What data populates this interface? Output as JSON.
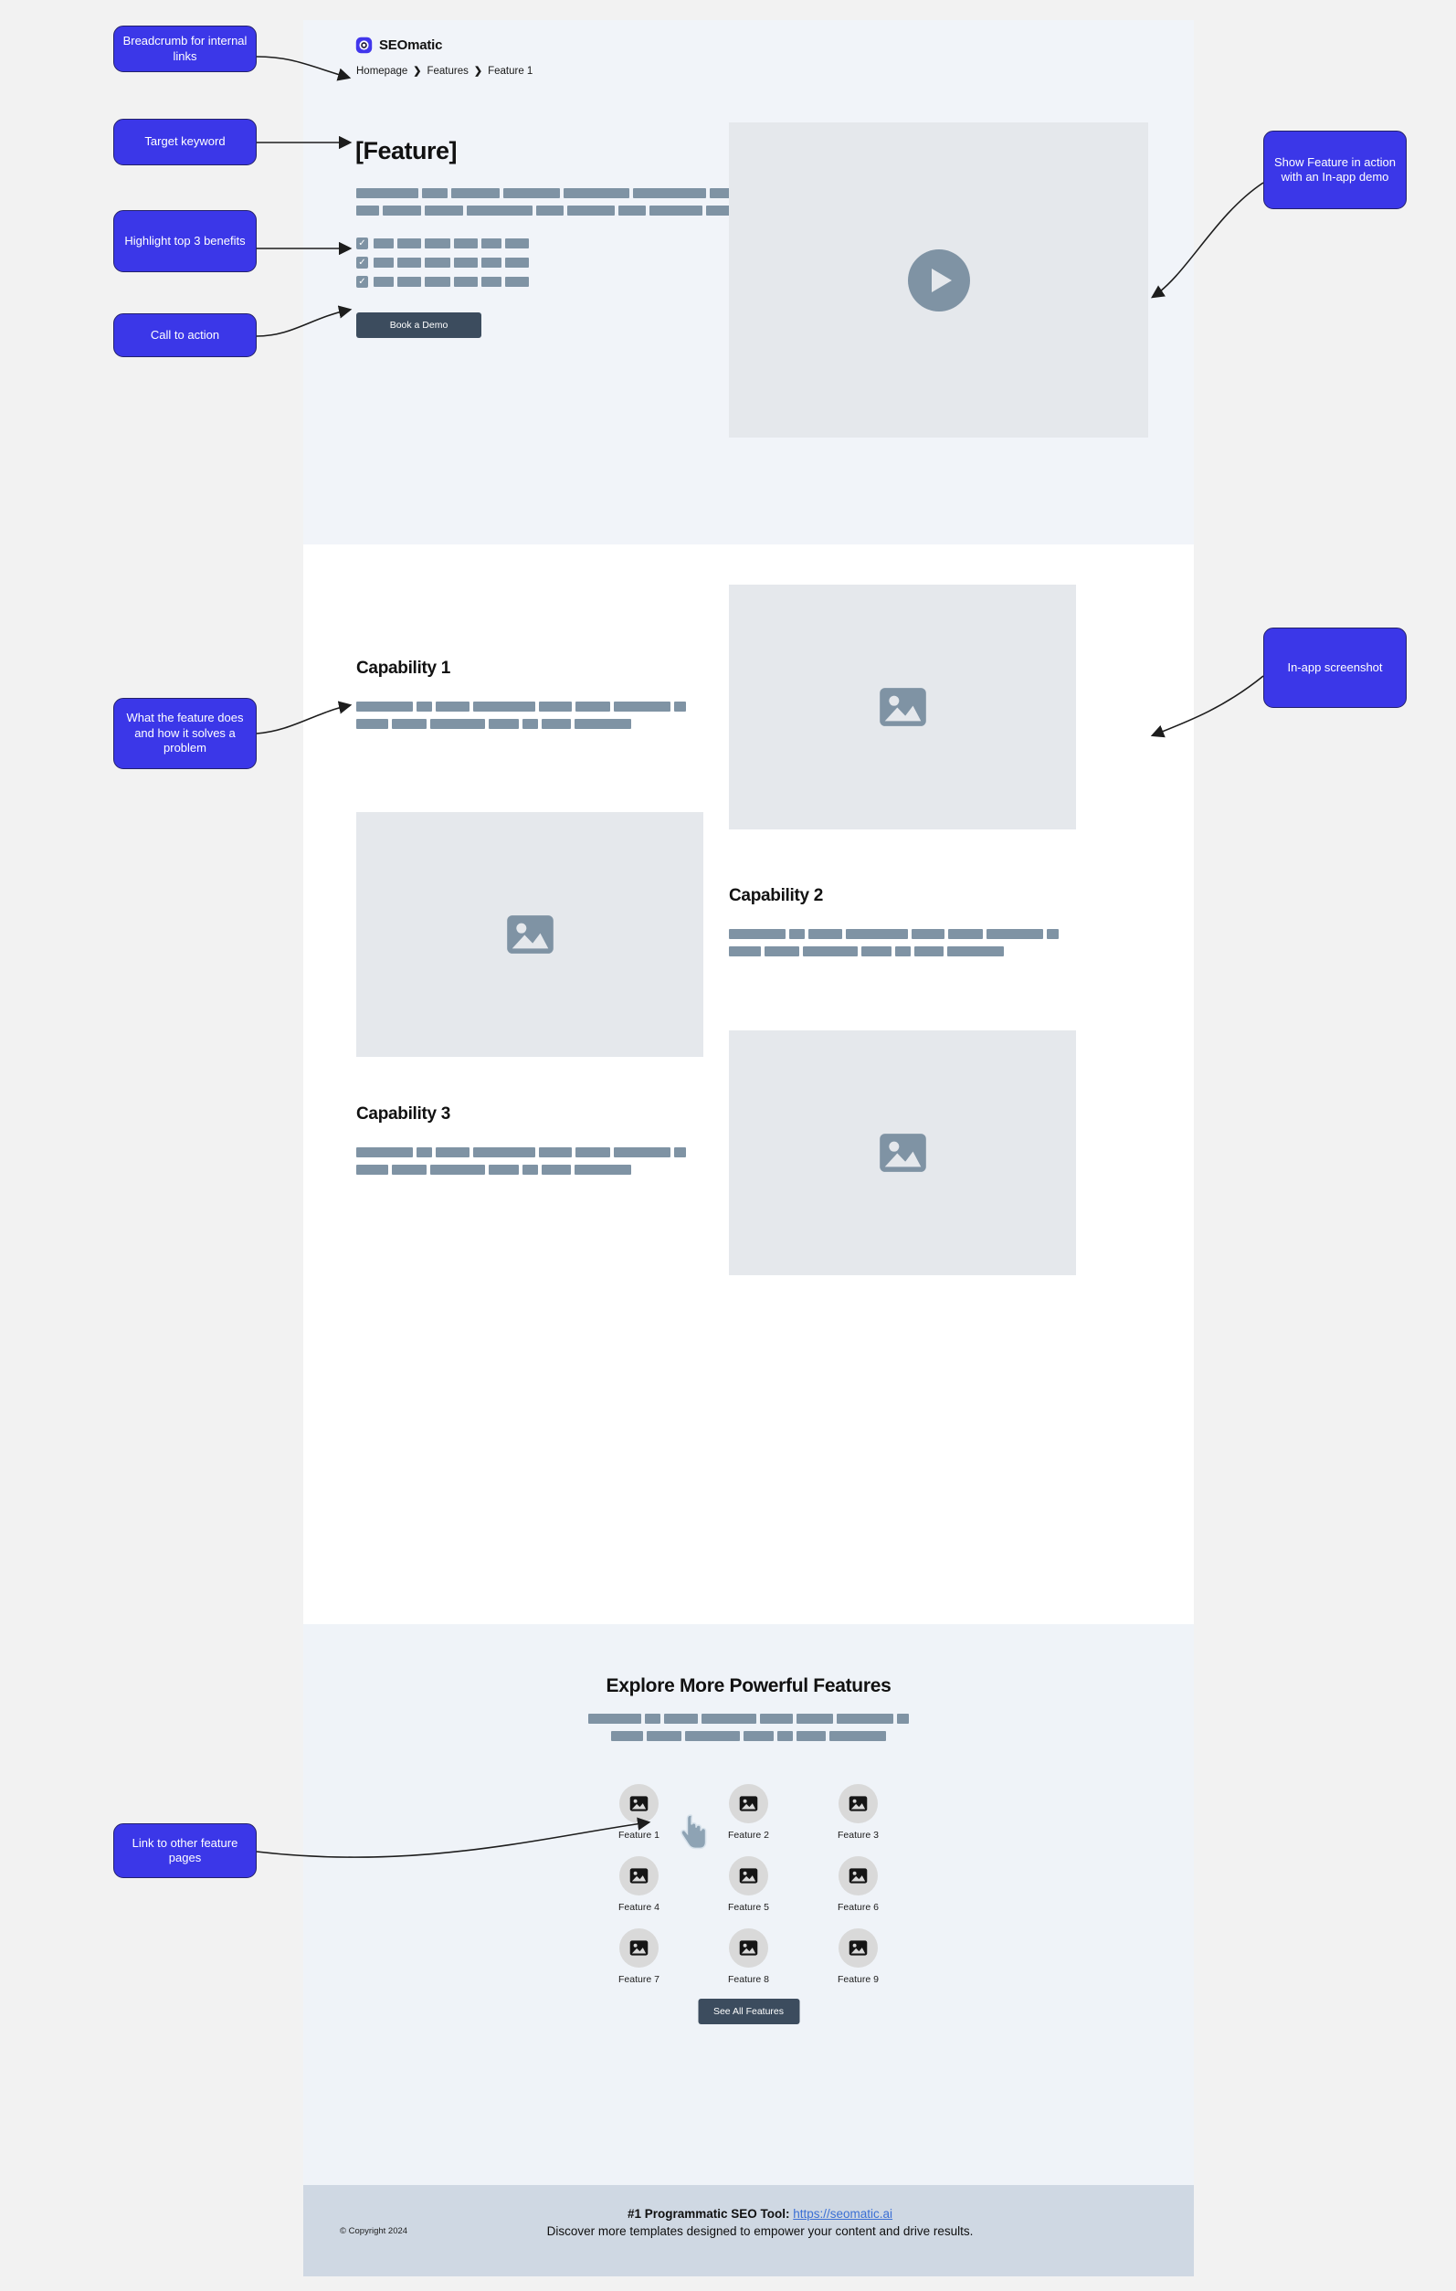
{
  "brand": {
    "name": "SEOmatic",
    "logo_icon": "seomatic-logo-icon"
  },
  "breadcrumb": {
    "items": [
      "Homepage",
      "Features",
      "Feature 1"
    ],
    "separator": "❯"
  },
  "hero": {
    "title": "[Feature]",
    "paragraph_bars": [
      [
        68,
        28,
        53,
        62,
        72,
        80,
        48,
        15
      ],
      [
        25,
        42,
        42,
        72,
        30,
        52,
        30,
        58,
        58
      ]
    ],
    "bullets": [
      {
        "checked": true,
        "icon": "checkbox-checked-icon",
        "bars": [
          22,
          26,
          28,
          26,
          22,
          26
        ]
      },
      {
        "checked": true,
        "icon": "checkbox-checked-icon",
        "bars": [
          22,
          26,
          28,
          26,
          22,
          26
        ]
      },
      {
        "checked": true,
        "icon": "checkbox-checked-icon",
        "bars": [
          22,
          26,
          28,
          26,
          22,
          26
        ]
      }
    ],
    "cta_label": "Book a Demo",
    "video": {
      "icon": "play-button-icon"
    }
  },
  "capabilities": [
    {
      "title": "Capability 1",
      "paragraph_bars": [
        [
          62,
          17,
          37,
          68,
          36,
          38,
          62,
          13
        ],
        [
          35,
          38,
          60,
          33,
          17,
          32,
          62
        ]
      ],
      "image_icon": "image-placeholder-icon",
      "image_side": "right"
    },
    {
      "title": "Capability 2",
      "paragraph_bars": [
        [
          62,
          17,
          37,
          68,
          36,
          38,
          62,
          13
        ],
        [
          35,
          38,
          60,
          33,
          17,
          32,
          62
        ]
      ],
      "image_icon": "image-placeholder-icon",
      "image_side": "left"
    },
    {
      "title": "Capability 3",
      "paragraph_bars": [
        [
          62,
          17,
          37,
          68,
          36,
          38,
          62,
          13
        ],
        [
          35,
          38,
          60,
          33,
          17,
          32,
          62
        ]
      ],
      "image_icon": "image-placeholder-icon",
      "image_side": "right"
    }
  ],
  "explore": {
    "title": "Explore More Powerful Features",
    "paragraph_bars": [
      [
        58,
        17,
        37,
        60,
        36,
        40,
        62,
        13
      ],
      [
        35,
        38,
        60,
        33,
        17,
        32,
        62
      ]
    ],
    "features": [
      {
        "label": "Feature 1",
        "icon": "image-placeholder-icon"
      },
      {
        "label": "Feature 2",
        "icon": "image-placeholder-icon"
      },
      {
        "label": "Feature 3",
        "icon": "image-placeholder-icon"
      },
      {
        "label": "Feature 4",
        "icon": "image-placeholder-icon"
      },
      {
        "label": "Feature 5",
        "icon": "image-placeholder-icon"
      },
      {
        "label": "Feature 6",
        "icon": "image-placeholder-icon"
      },
      {
        "label": "Feature 7",
        "icon": "image-placeholder-icon"
      },
      {
        "label": "Feature 8",
        "icon": "image-placeholder-icon"
      },
      {
        "label": "Feature 9",
        "icon": "image-placeholder-icon"
      }
    ],
    "see_all_label": "See All Features",
    "cursor_icon": "hand-pointer-cursor"
  },
  "footer": {
    "copyright": "© Copyright 2024",
    "tagline_strong": "#1 Programmatic SEO Tool:",
    "tagline_link": "https://seomatic.ai",
    "tagline_rest": "Discover more templates designed to empower your content and drive results."
  },
  "annotations": [
    {
      "id": "breadcrumb-note",
      "text": "Breadcrumb for internal links"
    },
    {
      "id": "keyword-note",
      "text": "Target keyword"
    },
    {
      "id": "benefits-note",
      "text": "Highlight top 3 benefits"
    },
    {
      "id": "cta-note",
      "text": "Call to action"
    },
    {
      "id": "demo-note",
      "text": "Show Feature in action with an In-app demo"
    },
    {
      "id": "problem-note",
      "text": "What the feature does and how it solves a problem"
    },
    {
      "id": "screenshot-note",
      "text": "In-app screenshot"
    },
    {
      "id": "links-note",
      "text": "Link to other feature pages"
    }
  ],
  "colors": {
    "annotation_fill": "#3b37e8",
    "annotation_border": "#23216b",
    "hero_bg": "#f1f4f9",
    "explore_bg": "#eff3f8",
    "footer_bg": "#cfd8e3",
    "placeholder_bar": "#7f93a4",
    "media_bg": "#e5e8ec",
    "button_bg": "#3c4c5e",
    "link": "#3b6fd4"
  }
}
